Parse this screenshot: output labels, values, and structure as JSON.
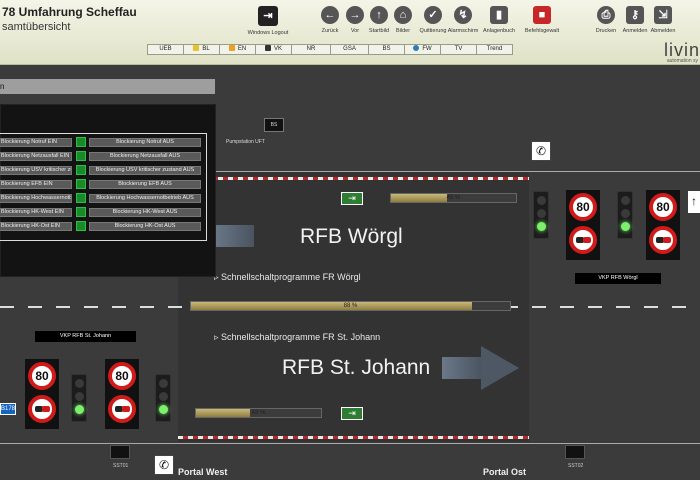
{
  "header": {
    "title": "78 Umfahrung Scheffau",
    "subtitle": "samtübersicht",
    "logout_label": "Windows Logout",
    "toolbar": [
      {
        "label": "Zurück",
        "icon": "arrow-left-icon"
      },
      {
        "label": "Vor",
        "icon": "arrow-right-icon"
      },
      {
        "label": "Startbild",
        "icon": "arrow-up-icon"
      },
      {
        "label": "Bilder",
        "icon": "home-icon"
      },
      {
        "label": "Quittierung",
        "icon": "check-icon"
      },
      {
        "label": "Alarmschirm",
        "icon": "alarm-icon"
      },
      {
        "label": "Anlagenbuch",
        "icon": "book-icon"
      },
      {
        "label": "Befehlsgewalt",
        "icon": "command-icon"
      },
      {
        "label": "Drucken",
        "icon": "printer-icon"
      },
      {
        "label": "Anmelden",
        "icon": "key-icon"
      },
      {
        "label": "Abmelden",
        "icon": "logout-icon"
      }
    ],
    "logo_big": "livin",
    "logo_small": "automation sy"
  },
  "nav_tabs": [
    {
      "label": "UEB",
      "icon": ""
    },
    {
      "label": "BL",
      "icon": "lamp-icon"
    },
    {
      "label": "EN",
      "icon": "lightning-icon"
    },
    {
      "label": "VK",
      "icon": "traffic-icon"
    },
    {
      "label": "NR",
      "icon": ""
    },
    {
      "label": "GSA",
      "icon": ""
    },
    {
      "label": "BS",
      "icon": ""
    },
    {
      "label": "FW",
      "icon": "globe-icon"
    },
    {
      "label": "TV",
      "icon": ""
    },
    {
      "label": "Trend",
      "icon": ""
    }
  ],
  "strip_label": "n",
  "bs_button": "BS",
  "pump_label": "Pumpstation UFT",
  "controls": [
    {
      "left": "Blockierung Notruf EIN",
      "right": "Blockierung Notruf AUS"
    },
    {
      "left": "Blockierung Netzausfall EIN",
      "right": "Blockierung Netzausfall AUS"
    },
    {
      "left": "Blockierung USV kritischer zustand EIN",
      "right": "Blockierung USV kritischer zustand AUS"
    },
    {
      "left": "Blockierung EFB EIN",
      "right": "Blockierung EFB AUS"
    },
    {
      "left": "Blockierung Hochwassernotbetrieb EIN",
      "right": "Blockierung Hochwassernotbetrieb AUS"
    },
    {
      "left": "Blockierung HK-West EIN",
      "right": "Blockierung HK-West AUS"
    },
    {
      "left": "Blockierung HK-Ost EIN",
      "right": "Blockierung HK-Ost AUS"
    }
  ],
  "tunnel": {
    "woergl": {
      "title": "RFB Wörgl",
      "program": "Schnellschaltprogramme FR Wörgl",
      "progress_label": "45 %",
      "progress_value": 45
    },
    "johann": {
      "title": "RFB St. Johann",
      "program": "Schnellschaltprogramme FR St. Johann",
      "progress_label": "43 %",
      "progress_value": 43
    },
    "center_label": "88 %",
    "center_value": 88
  },
  "vkp_woergl": "VKP RFB Wörgl",
  "vkp_johann": "VKP RFB St. Johann",
  "speed_limit": "80",
  "b178": "B178",
  "portal_west": "Portal West",
  "portal_ost": "Portal Ost",
  "sst_west": "SST01",
  "sst_ost": "SST02"
}
